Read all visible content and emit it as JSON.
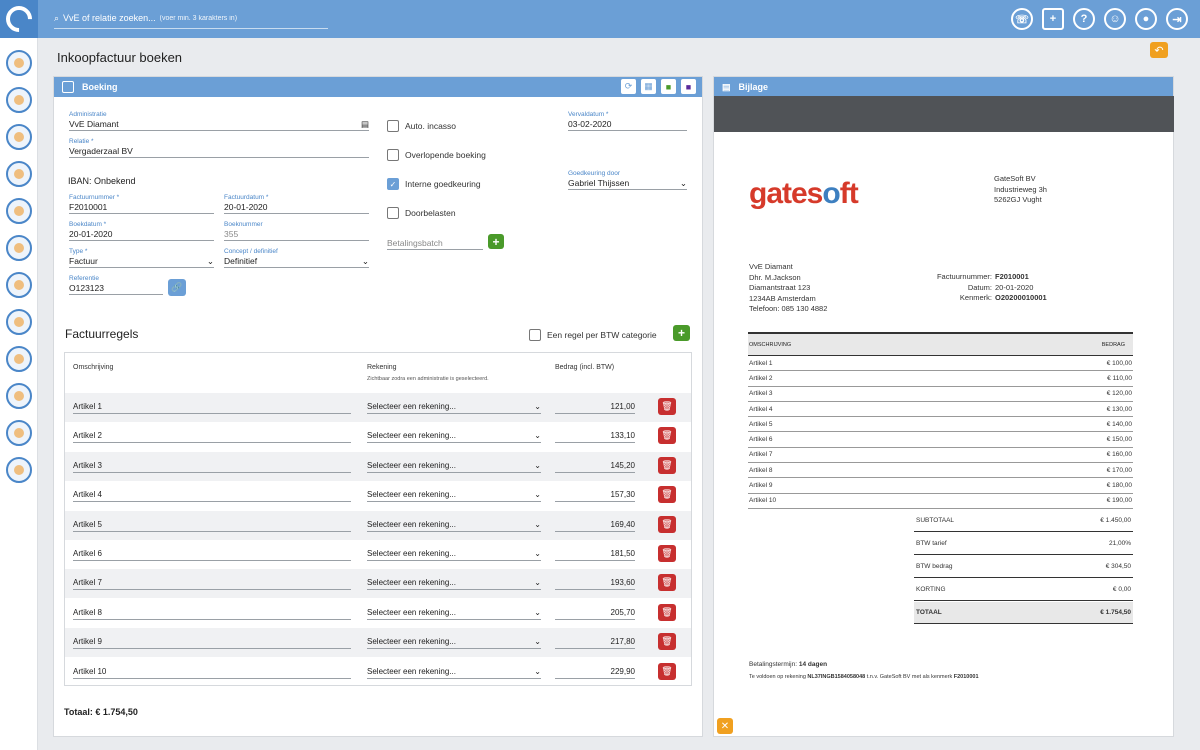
{
  "topbar": {
    "search_label": "VvE of relatie zoeken...",
    "search_hint": "(voer min. 3 karakters in)",
    "icons": [
      "phone-icon",
      "document-add-icon",
      "help-icon",
      "support-icon",
      "user-icon",
      "logout-icon"
    ]
  },
  "page": {
    "title": "Inkoopfactuur boeken"
  },
  "booking": {
    "header": "Boeking",
    "administratie_label": "Administratie",
    "administratie": "VvE Diamant",
    "relatie_label": "Relatie *",
    "relatie": "Vergaderzaal BV",
    "iban": "IBAN: Onbekend",
    "factuurnummer_label": "Factuurnummer *",
    "factuurnummer": "F2010001",
    "factuurdatum_label": "Factuurdatum *",
    "factuurdatum": "20-01-2020",
    "boekdatum_label": "Boekdatum *",
    "boekdatum": "20-01-2020",
    "boeknummer_label": "Boeknummer",
    "boeknummer": "355",
    "type_label": "Type *",
    "type": "Factuur",
    "concept_label": "Concept / definitief",
    "concept": "Definitief",
    "referentie_label": "Referentie",
    "referentie": "O123123",
    "auto_incasso": "Auto. incasso",
    "overlopende": "Overlopende boeking",
    "interne": "Interne goedkeuring",
    "doorbelasten": "Doorbelasten",
    "betalingsbatch": "Betalingsbatch",
    "vervaldatum_label": "Vervaldatum *",
    "vervaldatum": "03-02-2020",
    "goedkeuring_label": "Goedkeuring door",
    "goedkeuring": "Gabriel Thijssen"
  },
  "factuurregels": {
    "title": "Factuurregels",
    "btw_option": "Een regel per BTW categorie",
    "col_omschrijving": "Omschrijving",
    "col_rekening": "Rekening",
    "col_rekening_sub": "Zichtbaar zodra een administratie is geselecteerd.",
    "col_bedrag": "Bedrag (incl. BTW)",
    "rows": [
      {
        "desc": "Artikel 1",
        "account": "Selecteer een rekening...",
        "amount": "121,00"
      },
      {
        "desc": "Artikel 2",
        "account": "Selecteer een rekening...",
        "amount": "133,10"
      },
      {
        "desc": "Artikel 3",
        "account": "Selecteer een rekening...",
        "amount": "145,20"
      },
      {
        "desc": "Artikel 4",
        "account": "Selecteer een rekening...",
        "amount": "157,30"
      },
      {
        "desc": "Artikel 5",
        "account": "Selecteer een rekening...",
        "amount": "169,40"
      },
      {
        "desc": "Artikel 6",
        "account": "Selecteer een rekening...",
        "amount": "181,50"
      },
      {
        "desc": "Artikel 7",
        "account": "Selecteer een rekening...",
        "amount": "193,60"
      },
      {
        "desc": "Artikel 8",
        "account": "Selecteer een rekening...",
        "amount": "205,70"
      },
      {
        "desc": "Artikel 9",
        "account": "Selecteer een rekening...",
        "amount": "217,80"
      },
      {
        "desc": "Artikel 10",
        "account": "Selecteer een rekening...",
        "amount": "229,90"
      }
    ],
    "total": "Totaal: € 1.754,50"
  },
  "bijlage": {
    "header": "Bijlage",
    "logo_text": "gatesoft",
    "company": [
      "GateSoft BV",
      "Industrieweg 3h",
      "5262GJ Vught"
    ],
    "recipient": [
      "VvE Diamant",
      "Dhr. M.Jackson",
      "Diamantstraat 123",
      "1234AB Amsterdam",
      "Telefoon: 085 130 4882"
    ],
    "meta": [
      {
        "label": "Factuurnummer:",
        "value": "F2010001"
      },
      {
        "label": "Datum:",
        "value": "20-01-2020"
      },
      {
        "label": "Kenmerk:",
        "value": "O20200010001"
      }
    ],
    "col_omschrijving": "OMSCHRIJVING",
    "col_bedrag": "BEDRAG",
    "lines": [
      {
        "desc": "Artikel 1",
        "amount": "€ 100,00"
      },
      {
        "desc": "Artikel 2",
        "amount": "€ 110,00"
      },
      {
        "desc": "Artikel 3",
        "amount": "€ 120,00"
      },
      {
        "desc": "Artikel 4",
        "amount": "€ 130,00"
      },
      {
        "desc": "Artikel 5",
        "amount": "€ 140,00"
      },
      {
        "desc": "Artikel 6",
        "amount": "€ 150,00"
      },
      {
        "desc": "Artikel 7",
        "amount": "€ 160,00"
      },
      {
        "desc": "Artikel 8",
        "amount": "€ 170,00"
      },
      {
        "desc": "Artikel 9",
        "amount": "€ 180,00"
      },
      {
        "desc": "Artikel 10",
        "amount": "€ 190,00"
      }
    ],
    "summary": [
      {
        "label": "SUBTOTAAL",
        "value": "€ 1.450,00"
      },
      {
        "label": "BTW tarief",
        "value": "21,00%"
      },
      {
        "label": "BTW bedrag",
        "value": "€ 304,50"
      },
      {
        "label": "KORTING",
        "value": "€ 0,00"
      },
      {
        "label": "TOTAAL",
        "value": "€ 1.754,50"
      }
    ],
    "payment_term_label": "Betalingstermijn:",
    "payment_term": "14 dagen",
    "payment_note_prefix": "Te voldoen op rekening",
    "payment_iban": "NL37INGB1584058048",
    "payment_note_mid": "t.n.v. GateSoft BV met als kenmerk",
    "payment_ref": "F2010001"
  },
  "colors": {
    "accent": "#6b9fd6",
    "green": "#4a9a2a",
    "red": "#c72f2f",
    "orange": "#f0a020"
  }
}
